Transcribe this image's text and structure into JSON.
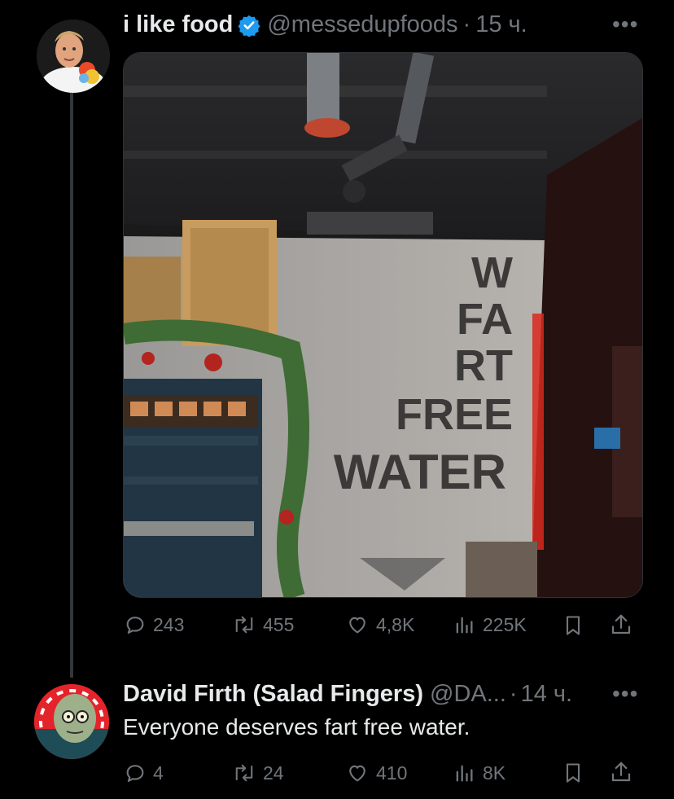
{
  "tweet": {
    "display_name": "i like food",
    "handle": "@messedupfoods",
    "separator": "·",
    "time": "15 ч.",
    "more_icon": "more-dots-icon",
    "image_sign_text": [
      "W",
      "FA",
      "RT",
      "FREE",
      "WATER"
    ],
    "actions": {
      "replies": "243",
      "reposts": "455",
      "likes": "4,8K",
      "views": "225K"
    }
  },
  "reply": {
    "display_name": "David Firth (Salad Fingers)",
    "handle": "@DA...",
    "separator": "·",
    "time": "14 ч.",
    "text": "Everyone deserves fart free water.",
    "actions": {
      "replies": "4",
      "reposts": "24",
      "likes": "410",
      "views": "8K"
    }
  },
  "colors": {
    "background": "#000000",
    "text": "#e7e9ea",
    "muted": "#71767b",
    "verified": "#1d9bf0"
  }
}
